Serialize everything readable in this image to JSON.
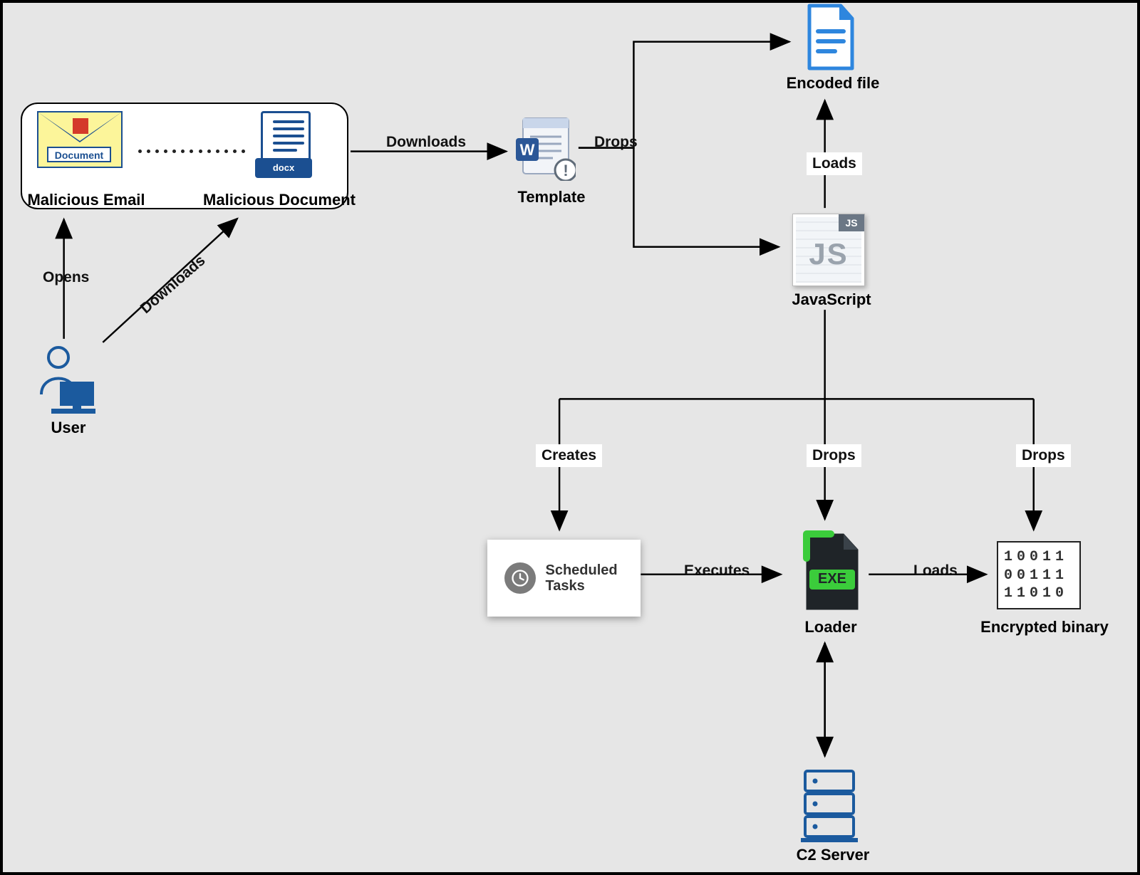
{
  "nodes": {
    "email": {
      "label": "Malicious Email",
      "tag": "Document"
    },
    "doc": {
      "label": "Malicious Document",
      "ext": "docx"
    },
    "user": {
      "label": "User"
    },
    "template": {
      "label": "Template"
    },
    "encoded_file": {
      "label": "Encoded file"
    },
    "javascript": {
      "label": "JavaScript",
      "badge": "JS",
      "big": "JS"
    },
    "scheduled_tasks": {
      "label": "Scheduled Tasks"
    },
    "loader": {
      "label": "Loader",
      "tag": "EXE"
    },
    "encrypted_binary": {
      "label": "Encrypted binary",
      "rows": [
        "10011",
        "00111",
        "11010"
      ]
    },
    "c2": {
      "label": "C2 Server"
    }
  },
  "edges": {
    "opens": "Opens",
    "downloads1": "Downloads",
    "downloads2": "Downloads",
    "drops_template": "Drops",
    "loads_encoded": "Loads",
    "creates": "Creates",
    "drops_loader": "Drops",
    "drops_binary": "Drops",
    "executes": "Executes",
    "loads_binary": "Loads"
  }
}
